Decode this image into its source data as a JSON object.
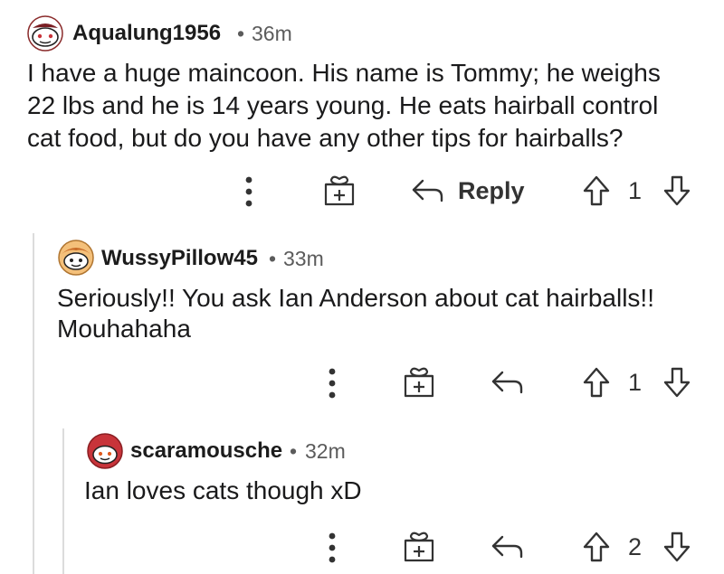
{
  "comments": [
    {
      "username": "Aqualung1956",
      "separator": "•",
      "time": "36m",
      "text_lines": [
        "I have a huge maincoon. His name is Tommy; he weighs",
        "22 lbs and he is 14 years young. He eats hairball control",
        "cat food, but do you have any other tips for hairballs?"
      ],
      "reply_label": "Reply",
      "score": "1",
      "avatar_icon": "snoo-avatar-icon"
    },
    {
      "username": "WussyPillow45",
      "separator": "•",
      "time": "33m",
      "text_lines": [
        "Seriously!! You ask Ian Anderson about cat hairballs!!",
        "Mouhahaha"
      ],
      "score": "1",
      "avatar_icon": "snoo-avatar-icon"
    },
    {
      "username": "scaramousche",
      "separator": "•",
      "time": "32m",
      "text_lines": [
        "Ian loves cats though xD"
      ],
      "score": "2",
      "avatar_icon": "snoo-avatar-icon"
    }
  ],
  "icons": [
    "more-options-icon",
    "gift-award-icon",
    "reply-arrow-icon",
    "upvote-arrow-icon",
    "downvote-arrow-icon"
  ],
  "colors": {
    "text": "#1a1a1b",
    "meta": "#5b5b5b",
    "thread_line": "#dcdcdc",
    "avatar_red": "#c8343a"
  }
}
